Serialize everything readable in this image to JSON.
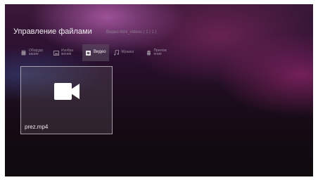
{
  "header": {
    "title": "Управление файлами",
    "subtitle": "Видео-/kini_videos ( 1 | 1 )"
  },
  "tabs": [
    {
      "label": "Оборудо вание",
      "icon": "hardware-icon",
      "active": false
    },
    {
      "label": "Изобра жения",
      "icon": "image-icon",
      "active": false
    },
    {
      "label": "Видео",
      "icon": "video-icon",
      "active": true
    },
    {
      "label": "Музыка",
      "icon": "music-note-icon",
      "active": false
    },
    {
      "label": "Прилож ение",
      "icon": "android-icon",
      "active": false
    }
  ],
  "files": [
    {
      "name": "prez.mp4",
      "icon": "video-camera-icon",
      "selected": true
    }
  ],
  "colors": {
    "background_dark": "#0e0a0d",
    "background_purple": "#3a1838",
    "accent_glow": "#b05caa",
    "text_primary": "#f2eef2",
    "text_muted": "#8c7f8e"
  }
}
